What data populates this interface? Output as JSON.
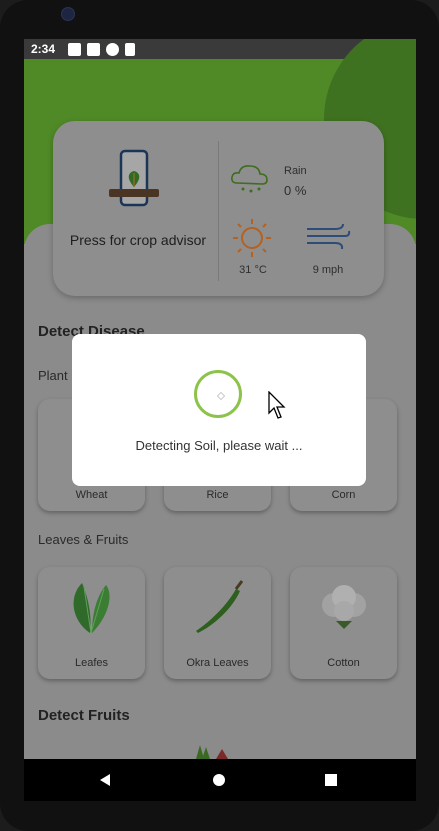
{
  "status_bar": {
    "time": "2:34"
  },
  "advisor": {
    "label": "Press for crop advisor"
  },
  "weather": {
    "rain_label": "Rain",
    "rain_value": "0 %",
    "temperature": "31 °C",
    "wind": "9 mph"
  },
  "detect_disease": {
    "title": "Detect Disease",
    "plants_title": "Plant",
    "plants": [
      {
        "label": "Wheat"
      },
      {
        "label": "Rice"
      },
      {
        "label": "Corn"
      }
    ],
    "leaves_title": "Leaves & Fruits",
    "leaves": [
      {
        "label": "Leafes"
      },
      {
        "label": "Okra Leaves"
      },
      {
        "label": "Cotton"
      }
    ]
  },
  "detect_fruits": {
    "title": "Detect Fruits"
  },
  "dialog": {
    "message": "Detecting Soil, please wait ..."
  },
  "colors": {
    "accent_green": "#8cc34a",
    "header_green": "#4f8a27"
  }
}
